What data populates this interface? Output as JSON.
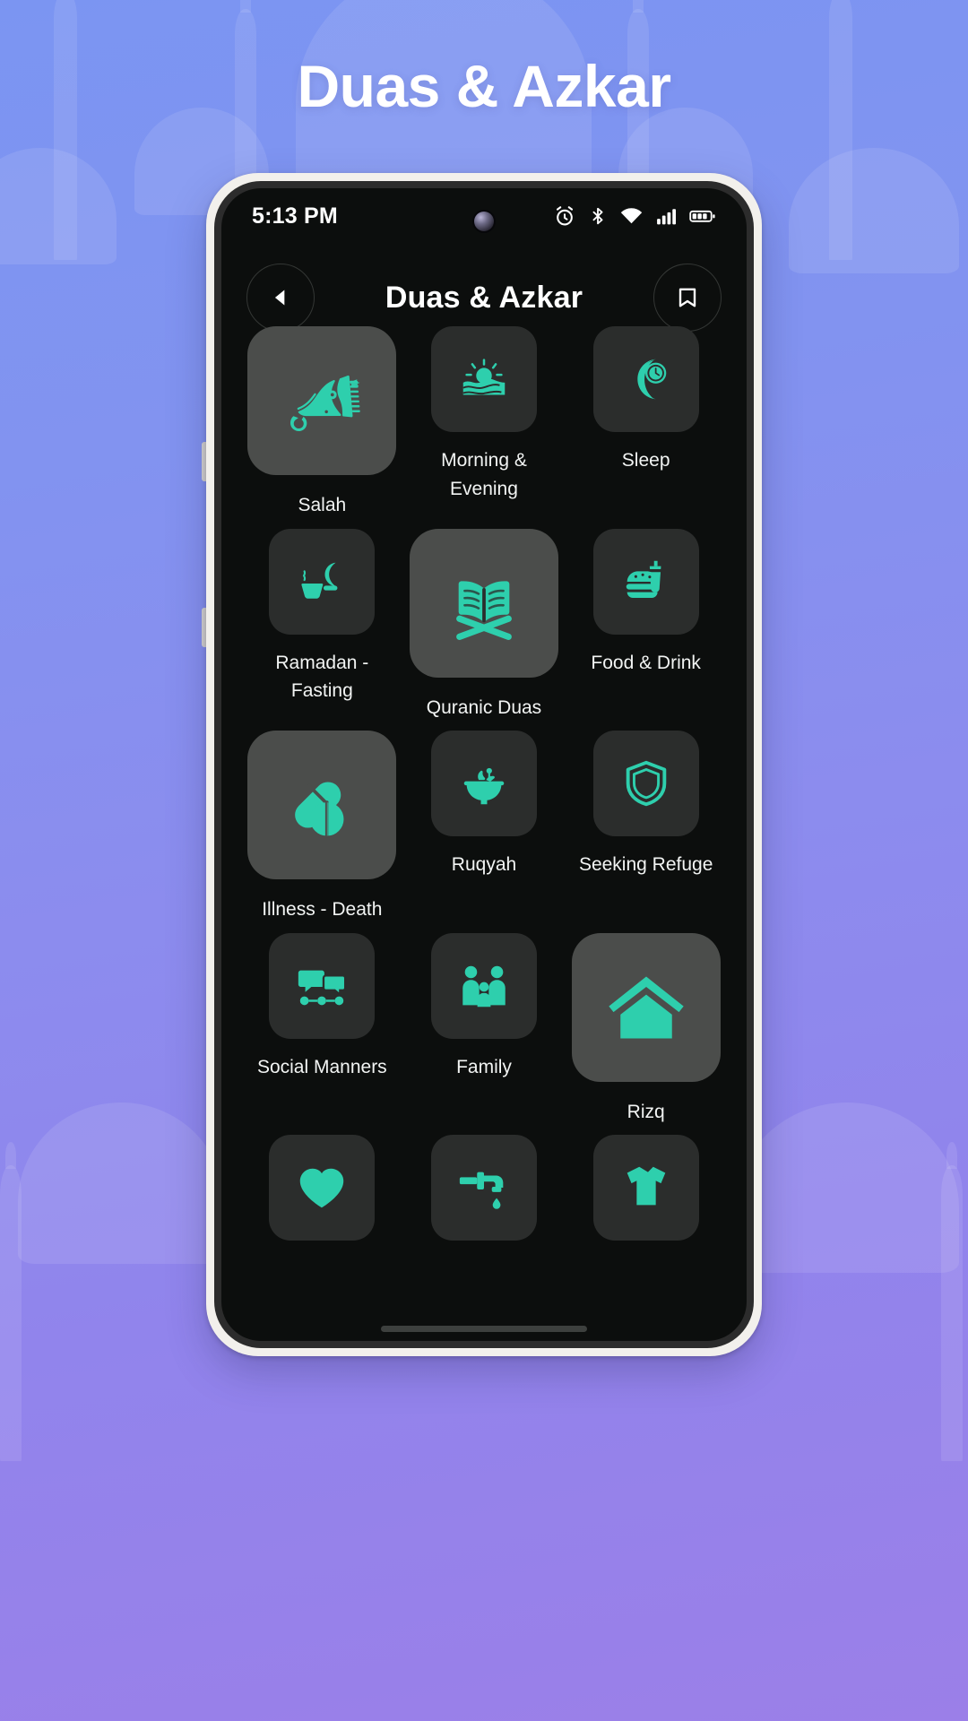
{
  "banner": {
    "title": "Duas & Azkar"
  },
  "phone": {
    "status_bar": {
      "time": "5:13 PM",
      "icons": [
        "alarm-icon",
        "bluetooth-icon",
        "wifi-icon",
        "signal-icon",
        "battery-icon"
      ]
    },
    "app_header": {
      "back_label": "",
      "title": "Duas & Azkar",
      "bookmark_label": ""
    },
    "grid": {
      "items": [
        {
          "label": "Salah",
          "icon": "prayer-mat-icon",
          "highlighted": true
        },
        {
          "label": "Morning & Evening",
          "icon": "sunrise-icon",
          "highlighted": false
        },
        {
          "label": "Sleep",
          "icon": "moon-clock-icon",
          "highlighted": false
        },
        {
          "label": "Ramadan - Fasting",
          "icon": "iftar-moon-icon",
          "highlighted": false
        },
        {
          "label": "Quranic Duas",
          "icon": "open-quran-icon",
          "highlighted": true
        },
        {
          "label": "Food & Drink",
          "icon": "burger-drink-icon",
          "highlighted": false
        },
        {
          "label": "Illness - Death",
          "icon": "pills-icon",
          "highlighted": true
        },
        {
          "label": "Ruqyah",
          "icon": "mortar-pestle-icon",
          "highlighted": false
        },
        {
          "label": "Seeking Refuge",
          "icon": "shield-icon",
          "highlighted": false
        },
        {
          "label": "Social Manners",
          "icon": "chat-group-icon",
          "highlighted": false
        },
        {
          "label": "Family",
          "icon": "family-icon",
          "highlighted": false
        },
        {
          "label": "Rizq",
          "icon": "home-icon",
          "highlighted": true
        },
        {
          "label": "",
          "icon": "heart-icon",
          "highlighted": false
        },
        {
          "label": "",
          "icon": "faucet-icon",
          "highlighted": false
        },
        {
          "label": "",
          "icon": "shirt-icon",
          "highlighted": false
        }
      ]
    }
  },
  "colors": {
    "accent": "#2ecfad",
    "screen_bg": "#0c0e0d",
    "tile_bg": "#2b2d2c",
    "tile_bg_active": "#4b4d4b",
    "text": "#f2f4f3",
    "banner_text": "#ffffff"
  }
}
